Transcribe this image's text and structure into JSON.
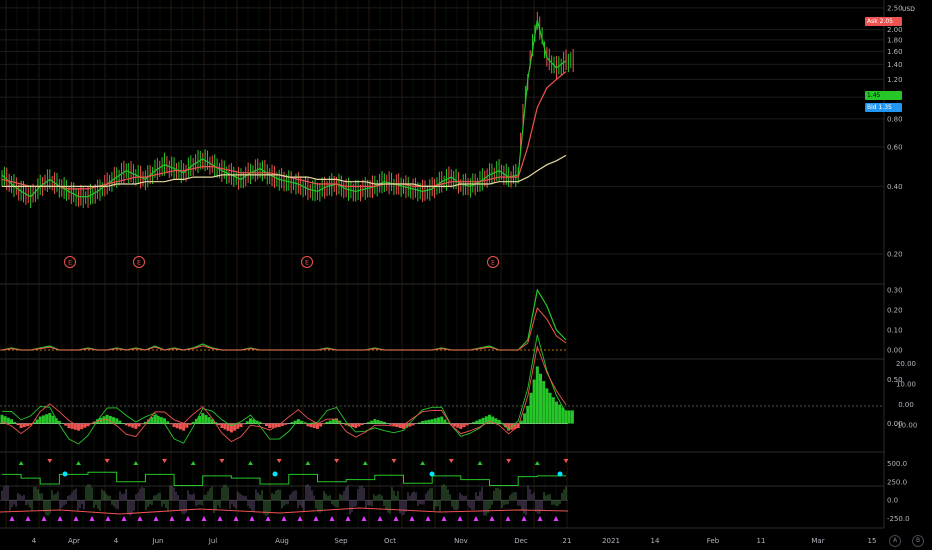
{
  "app": {
    "currency": "USD"
  },
  "price_axis": {
    "main_ticks": [
      "2.50",
      "2.00",
      "1.80",
      "1.60",
      "1.40",
      "1.20",
      "1.00",
      "0.80",
      "0.60",
      "0.40",
      "0.20"
    ],
    "pane2_ticks": [
      "0.30",
      "0.20",
      "0.10",
      "0.00"
    ],
    "pane3_left_ticks": [
      "0.50",
      "0.00"
    ],
    "pane3_right_ticks": [
      "20.00",
      "10.00",
      "0.00",
      "-10.00"
    ],
    "pane4_ticks": [
      "500.0",
      "250.0",
      "0.0",
      "-250.0"
    ]
  },
  "quotes": {
    "ask_label": "Ask",
    "ask_value": "2.05",
    "last_value": "1.45",
    "bid_label": "Bid",
    "bid_value": "1.35",
    "ask_color": "#ef5350",
    "last_color": "#26c629",
    "bid_color": "#2196f3"
  },
  "time_axis": [
    "4",
    "Apr",
    "4",
    "Jun",
    "Jul",
    "Aug",
    "Sep",
    "Oct",
    "Nov",
    "Dec",
    "21",
    "2021",
    "14",
    "Feb",
    "11",
    "Mar",
    "15"
  ],
  "earnings_marker": "E",
  "axis_buttons": {
    "auto": "A",
    "log": "B"
  },
  "colors": {
    "up": "#26c629",
    "down": "#ef5350",
    "ma_light": "#e6d9a0",
    "background": "#000000",
    "signal": "#00e5ff",
    "magenta": "#e040fb"
  },
  "chart_data": [
    {
      "type": "line",
      "title": "",
      "y_scale": "log",
      "ylim": [
        0.15,
        2.6
      ],
      "x_range": [
        "Mar 2020",
        "Mar 2021"
      ],
      "series": [
        {
          "values": [
            0.45,
            0.41,
            0.38,
            0.36,
            0.4,
            0.43,
            0.4,
            0.38,
            0.36,
            0.36,
            0.38,
            0.41,
            0.44,
            0.47,
            0.45,
            0.43,
            0.47,
            0.5,
            0.48,
            0.46,
            0.5,
            0.53,
            0.5,
            0.47,
            0.45,
            0.43,
            0.46,
            0.48,
            0.45,
            0.43,
            0.42,
            0.41,
            0.39,
            0.38,
            0.4,
            0.41,
            0.39,
            0.38,
            0.39,
            0.4,
            0.42,
            0.41,
            0.4,
            0.39,
            0.38,
            0.39,
            0.42,
            0.44,
            0.41,
            0.4,
            0.42,
            0.45,
            0.47,
            0.44,
            0.45,
            1.2,
            2.2,
            1.5,
            1.35,
            1.45
          ]
        },
        {
          "values": [
            0.43,
            0.42,
            0.41,
            0.4,
            0.4,
            0.4,
            0.4,
            0.39,
            0.39,
            0.39,
            0.4,
            0.41,
            0.42,
            0.43,
            0.44,
            0.44,
            0.45,
            0.46,
            0.47,
            0.47,
            0.48,
            0.49,
            0.49,
            0.48,
            0.47,
            0.46,
            0.46,
            0.46,
            0.46,
            0.45,
            0.44,
            0.43,
            0.42,
            0.41,
            0.41,
            0.41,
            0.4,
            0.4,
            0.4,
            0.4,
            0.41,
            0.41,
            0.41,
            0.4,
            0.4,
            0.4,
            0.41,
            0.42,
            0.42,
            0.42,
            0.42,
            0.43,
            0.44,
            0.44,
            0.44,
            0.6,
            0.9,
            1.1,
            1.2,
            1.3
          ]
        },
        {
          "values": [
            0.4,
            0.4,
            0.4,
            0.4,
            0.4,
            0.4,
            0.4,
            0.4,
            0.4,
            0.4,
            0.4,
            0.4,
            0.41,
            0.41,
            0.41,
            0.42,
            0.42,
            0.42,
            0.43,
            0.43,
            0.44,
            0.44,
            0.44,
            0.45,
            0.45,
            0.45,
            0.45,
            0.45,
            0.45,
            0.45,
            0.44,
            0.44,
            0.44,
            0.43,
            0.43,
            0.43,
            0.42,
            0.42,
            0.42,
            0.41,
            0.41,
            0.41,
            0.41,
            0.41,
            0.4,
            0.4,
            0.4,
            0.4,
            0.41,
            0.41,
            0.41,
            0.41,
            0.42,
            0.42,
            0.42,
            0.44,
            0.47,
            0.5,
            0.52,
            0.55
          ]
        }
      ]
    },
    {
      "type": "line",
      "title": "",
      "ylim": [
        -0.02,
        0.32
      ],
      "series": [
        {
          "values": [
            0.0,
            0.01,
            0.0,
            0.0,
            0.01,
            0.02,
            0.0,
            0.0,
            0.0,
            0.01,
            0.0,
            0.0,
            0.01,
            0.0,
            0.01,
            0.0,
            0.02,
            0.0,
            0.01,
            0.0,
            0.01,
            0.03,
            0.01,
            0.0,
            0.0,
            0.0,
            0.01,
            0.0,
            0.0,
            0.0,
            0.0,
            0.0,
            0.0,
            0.0,
            0.01,
            0.0,
            0.0,
            0.0,
            0.0,
            0.01,
            0.0,
            0.0,
            0.0,
            0.0,
            0.0,
            0.0,
            0.01,
            0.0,
            0.0,
            0.0,
            0.01,
            0.02,
            0.0,
            0.0,
            0.0,
            0.05,
            0.3,
            0.22,
            0.1,
            0.05
          ]
        }
      ]
    },
    {
      "type": "area",
      "title": "",
      "ylim": [
        -0.3,
        0.7
      ],
      "series": [
        {
          "values": [
            0.1,
            0.05,
            -0.05,
            -0.02,
            0.08,
            0.12,
            0.03,
            -0.05,
            -0.08,
            -0.03,
            0.05,
            0.1,
            0.06,
            -0.02,
            -0.06,
            0.02,
            0.1,
            0.06,
            -0.04,
            -0.08,
            0.02,
            0.12,
            0.05,
            -0.05,
            -0.1,
            -0.04,
            0.06,
            0.02,
            -0.05,
            -0.04,
            0.0,
            0.05,
            -0.03,
            -0.06,
            0.02,
            0.06,
            -0.02,
            -0.05,
            0.0,
            0.05,
            0.02,
            -0.03,
            -0.06,
            -0.02,
            0.03,
            0.05,
            0.08,
            -0.02,
            -0.06,
            0.0,
            0.05,
            0.1,
            0.04,
            -0.08,
            -0.05,
            0.2,
            0.65,
            0.4,
            0.25,
            0.15
          ]
        }
      ]
    },
    {
      "type": "line",
      "title": "",
      "ylim": [
        -350,
        600
      ],
      "series": [
        {
          "values": [
            350,
            350,
            300,
            300,
            220,
            220,
            350,
            350,
            350,
            380,
            380,
            380,
            250,
            250,
            250,
            350,
            350,
            350,
            200,
            200,
            200,
            330,
            330,
            330,
            300,
            300,
            300,
            220,
            220,
            220,
            350,
            350,
            350,
            250,
            250,
            250,
            280,
            280,
            280,
            340,
            340,
            340,
            230,
            230,
            230,
            330,
            330,
            330,
            280,
            280,
            280,
            200,
            200,
            200,
            320,
            320,
            330,
            330,
            330,
            330
          ]
        }
      ]
    }
  ]
}
